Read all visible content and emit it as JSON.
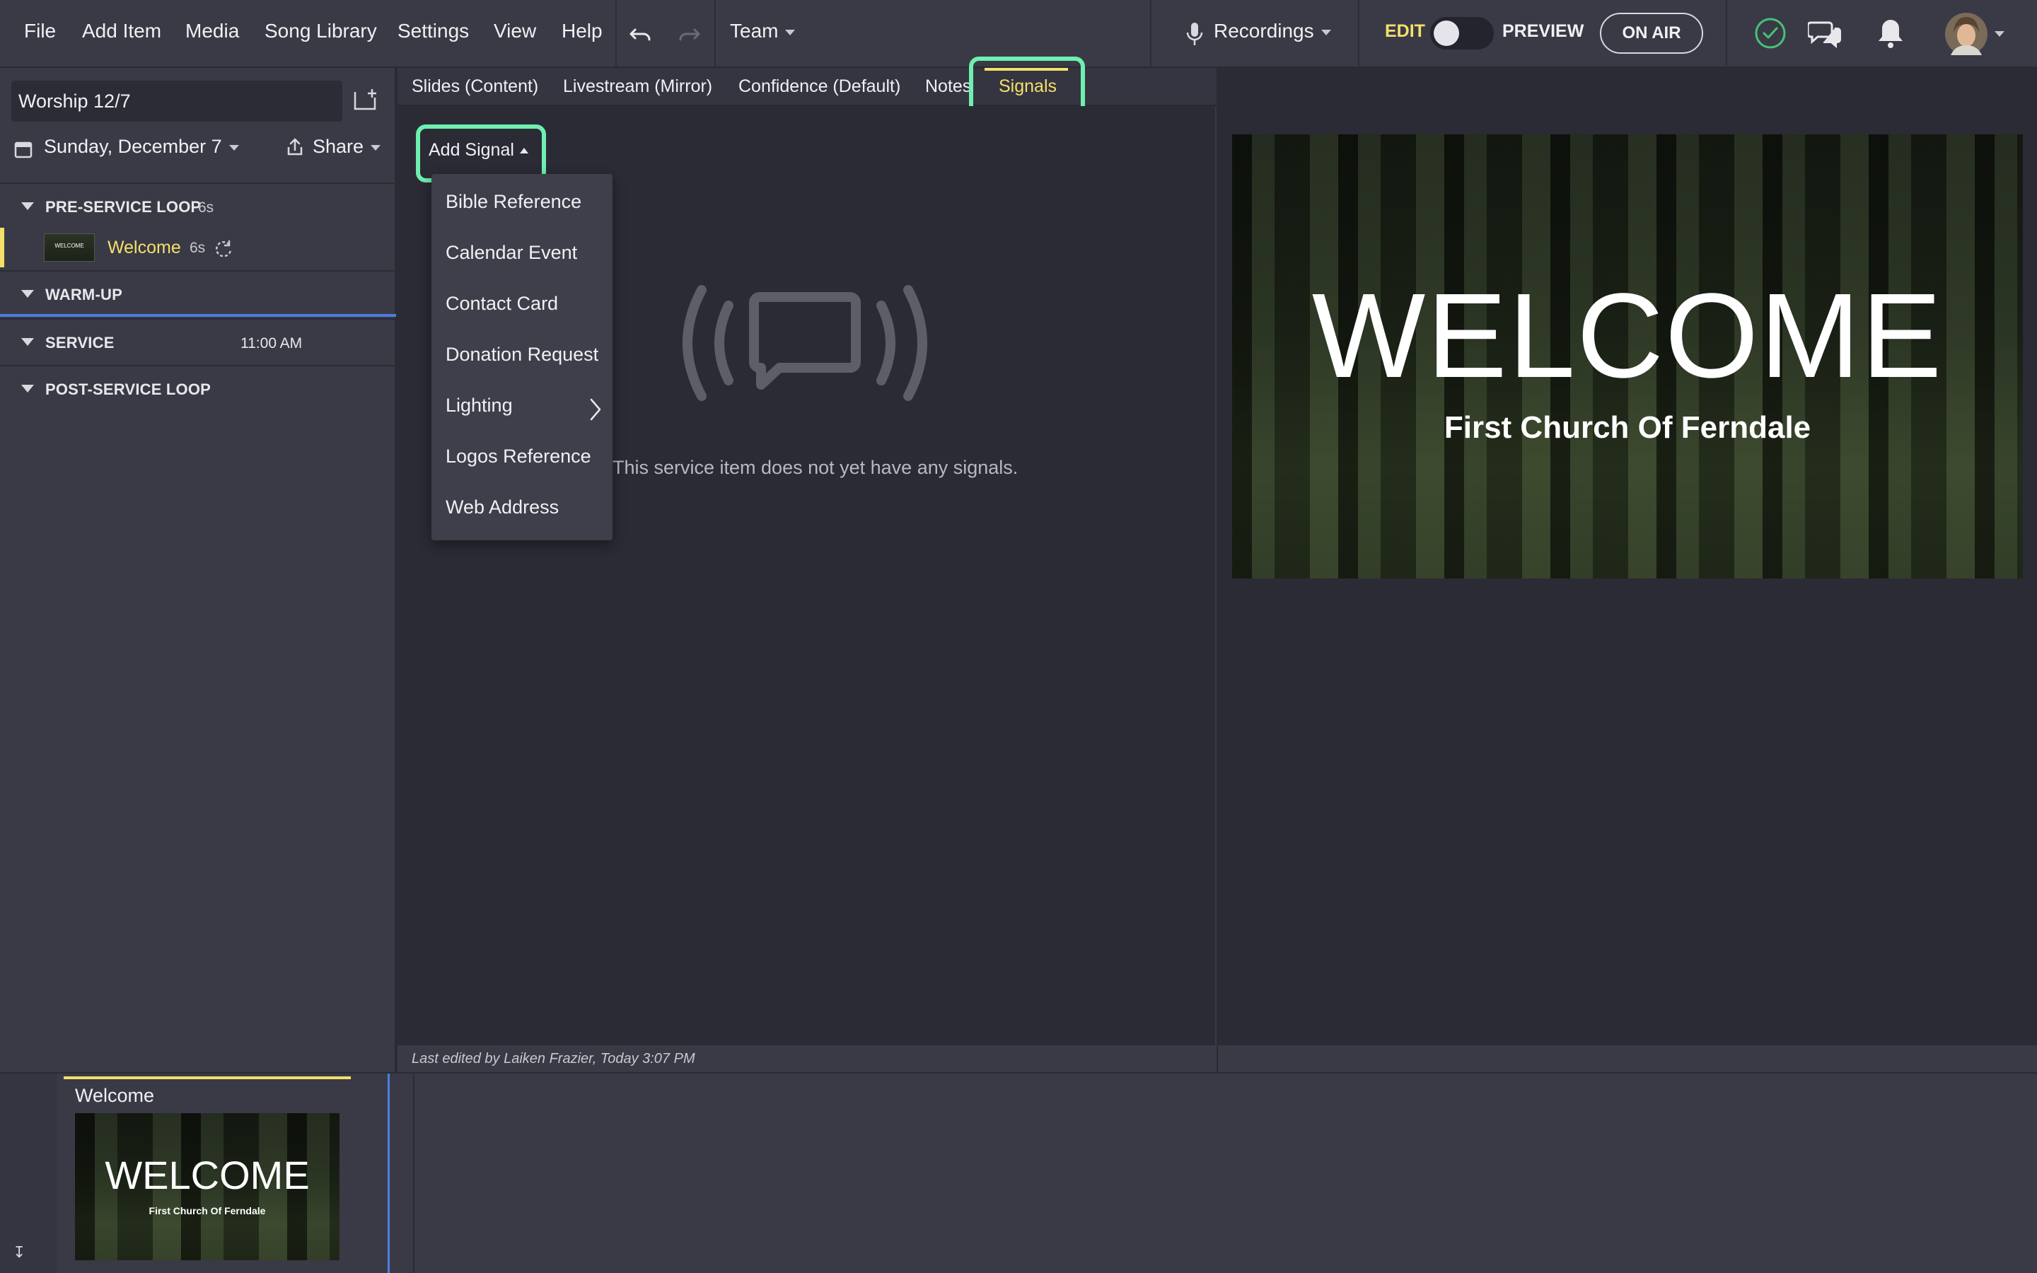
{
  "menu": {
    "file": "File",
    "add_item": "Add Item",
    "media": "Media",
    "song_library": "Song Library",
    "settings": "Settings",
    "view": "View",
    "help": "Help",
    "team": "Team",
    "recordings": "Recordings",
    "edit": "EDIT",
    "preview": "PREVIEW",
    "on_air": "ON AIR"
  },
  "icons": {
    "undo": "undo-icon",
    "redo": "redo-icon",
    "mic": "microphone-icon",
    "status": "check-circle-icon",
    "chat": "chat-icon",
    "bell": "bell-icon",
    "avatar": "avatar"
  },
  "colors": {
    "accent_yellow": "#f3e06a",
    "highlight_green": "#6ef0b0",
    "status_green": "#46c27a",
    "divider_blue": "#4e7de0"
  },
  "sidebar": {
    "plan_name": "Worship 12/7",
    "date": "Sunday, December 7",
    "share": "Share",
    "sections": [
      {
        "name": "PRE-SERVICE LOOP",
        "meta": "6s"
      },
      {
        "name": "WARM-UP",
        "meta": ""
      },
      {
        "name": "SERVICE",
        "meta": "11:00 AM"
      },
      {
        "name": "POST-SERVICE LOOP",
        "meta": ""
      }
    ],
    "items": [
      {
        "title": "Welcome",
        "duration": "6s",
        "thumb_text": "WELCOME"
      }
    ]
  },
  "tabs": [
    {
      "label": "Slides (Content)"
    },
    {
      "label": "Livestream (Mirror)"
    },
    {
      "label": "Confidence (Default)"
    },
    {
      "label": "Notes"
    },
    {
      "label": "Signals"
    }
  ],
  "signals": {
    "add_button": "Add Signal",
    "empty_message": "This service item does not yet have any signals.",
    "menu": [
      "Bible Reference",
      "Calendar Event",
      "Contact Card",
      "Donation Request",
      "Lighting",
      "Logos Reference",
      "Web Address"
    ]
  },
  "status_bar": {
    "last_edited": "Last edited by Laiken Frazier, Today 3:07 PM"
  },
  "preview": {
    "title": "WELCOME",
    "subtitle": "First Church Of Ferndale"
  },
  "filmstrip": {
    "label": "Welcome",
    "thumb_title": "WELCOME",
    "thumb_subtitle": "First Church Of Ferndale"
  }
}
